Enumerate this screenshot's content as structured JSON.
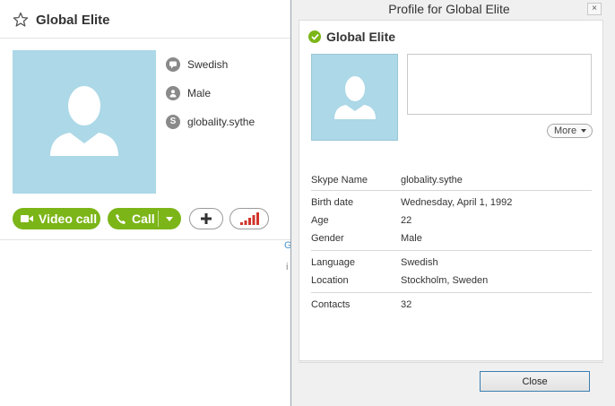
{
  "contact": {
    "name": "Global Elite",
    "language": "Swedish",
    "gender": "Male",
    "skype_name": "globality.sythe"
  },
  "actions": {
    "video_call_label": "Video call",
    "call_label": "Call"
  },
  "stray_text": {
    "g": "G",
    "i": "i"
  },
  "dialog": {
    "title": "Profile for Global Elite",
    "close_x": "×",
    "profile_name": "Global Elite",
    "more_label": "More",
    "close_label": "Close",
    "fields": {
      "skype_name": {
        "label": "Skype Name",
        "value": "globality.sythe"
      },
      "birth_date": {
        "label": "Birth date",
        "value": "Wednesday, April 1, 1992"
      },
      "age": {
        "label": "Age",
        "value": "22"
      },
      "gender": {
        "label": "Gender",
        "value": "Male"
      },
      "language": {
        "label": "Language",
        "value": "Swedish"
      },
      "location": {
        "label": "Location",
        "value": "Stockholm, Sweden"
      },
      "contacts": {
        "label": "Contacts",
        "value": "32"
      }
    }
  },
  "colors": {
    "accent_green": "#7cb518",
    "avatar_bg": "#acd8e7",
    "signal_red": "#d0342c",
    "button_border_blue": "#3c7fb1"
  },
  "icons": [
    "star-icon",
    "speech-bubble-icon",
    "person-icon",
    "skype-icon",
    "video-camera-icon",
    "phone-icon",
    "plus-icon",
    "signal-bars-icon",
    "status-check-icon",
    "close-icon"
  ]
}
